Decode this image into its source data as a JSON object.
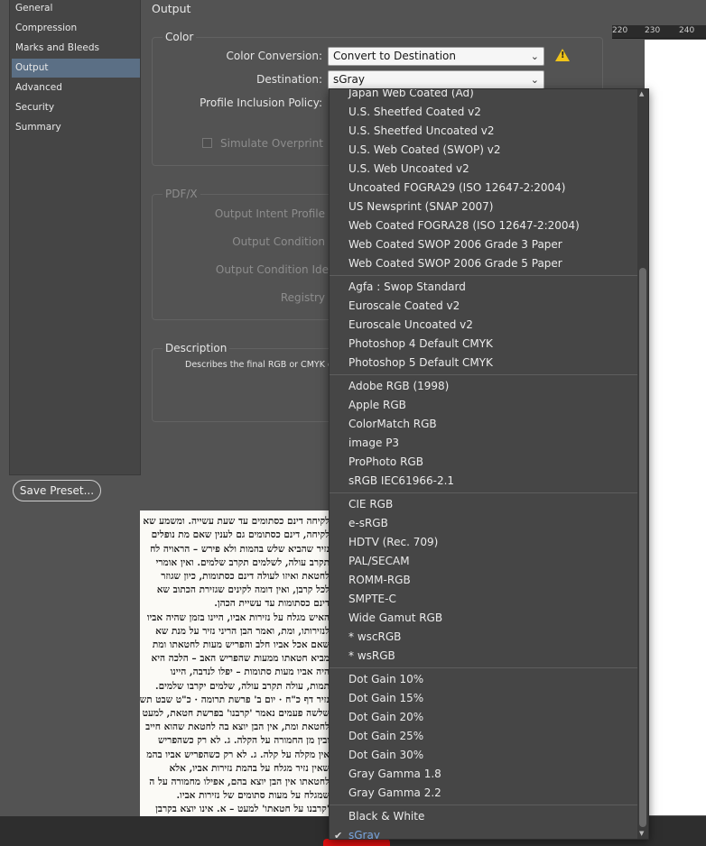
{
  "ruler": {
    "ticks": [
      "220",
      "230",
      "240"
    ]
  },
  "sidebar": {
    "items": [
      {
        "label": "General"
      },
      {
        "label": "Compression"
      },
      {
        "label": "Marks and Bleeds"
      },
      {
        "label": "Output"
      },
      {
        "label": "Advanced"
      },
      {
        "label": "Security"
      },
      {
        "label": "Summary"
      }
    ],
    "active": "Output"
  },
  "header": {
    "title": "Output"
  },
  "color_group": {
    "title": "Color",
    "conversion_label": "Color Conversion:",
    "conversion_value": "Convert to Destination",
    "destination_label": "Destination:",
    "destination_value": "sGray",
    "profile_label": "Profile Inclusion Policy:",
    "overprint_label": "Simulate Overprint"
  },
  "pdfx_group": {
    "title": "PDF/X",
    "intent_label": "Output Intent Profile",
    "condition_label": "Output Condition",
    "identifier_label": "Output Condition Ide",
    "registry_label": "Registry"
  },
  "description_group": {
    "title": "Description",
    "text": "Describes the final RGB or CMYK ou"
  },
  "buttons": {
    "save_preset": "Save Preset..."
  },
  "dropdown": {
    "selected": "sGray",
    "groups": [
      [
        "Japan Web Coated (Ad)",
        "U.S. Sheetfed Coated v2",
        "U.S. Sheetfed Uncoated v2",
        "U.S. Web Coated (SWOP) v2",
        "U.S. Web Uncoated v2",
        "Uncoated FOGRA29 (ISO 12647-2:2004)",
        "US Newsprint (SNAP 2007)",
        "Web Coated FOGRA28 (ISO 12647-2:2004)",
        "Web Coated SWOP 2006 Grade 3 Paper",
        "Web Coated SWOP 2006 Grade 5 Paper"
      ],
      [
        "Agfa : Swop Standard",
        "Euroscale Coated v2",
        "Euroscale Uncoated v2",
        "Photoshop 4 Default CMYK",
        "Photoshop 5 Default CMYK"
      ],
      [
        "Adobe RGB (1998)",
        "Apple RGB",
        "ColorMatch RGB",
        "image P3",
        "ProPhoto RGB",
        "sRGB IEC61966-2.1"
      ],
      [
        "CIE RGB",
        "e-sRGB",
        "HDTV (Rec. 709)",
        "PAL/SECAM",
        "ROMM-RGB",
        "SMPTE-C",
        "Wide Gamut RGB",
        "* wscRGB",
        "* wsRGB"
      ],
      [
        "Dot Gain 10%",
        "Dot Gain 15%",
        "Dot Gain 20%",
        "Dot Gain 25%",
        "Dot Gain 30%",
        "Gray Gamma 1.8",
        "Gray Gamma 2.2"
      ],
      [
        "Black & White",
        "sGray"
      ]
    ]
  },
  "document": {
    "lines": [
      "האחד חטאת ואת האחד עולה' – אמר רחמנא שאם",
      "לקיחה דינם כסתומים עד שעת עשייה. ומשמע שא",
      "לקיחה, דינם כסתומים גם לענין שאם מת נופלים",
      "נזיר שהביא שלש בהמות ולא פירש – הראויה לח",
      "תקרב עולה, לשלמים תקרב שלמים. ואין אומרי",
      "לחטאת ואיזו לעולה דינם כסתומות, כיון שגוזר",
      "לכל קרבן, ואין דומה לקינים שגזירת הכתוב שא",
      "דינם כסתומות עד עשיית הכהן.",
      "האיש מגלח על נזירות אביו, היינו בזמן שהיה אביו",
      "לנזירותו, ומת, ואמר הבן הריני נזיר על מנת שא",
      "שאם אכל אביו חלב והפריש מעות לחטאתו ומת",
      "מביא חטאתו ממעות שהפריש האב – הלכה היא",
      "היה אביו מעות סתומות – יפלו לנדבה, היינו",
      "תמות, עולה תקרב עולה, שלמים יקרבו שלמים.",
      "נזיר דף כ\"ח · יום ב' פרשת תרומה · כ\"ט שבט תשפ\"ג",
      "שלשה פעמים נאמר 'קרבנו' בפרשת חטאת, למעט",
      "לחטאת ומת, אין הבן יוצא בה לחטאת שהוא חייב",
      "ובין מן החמורה על הקלה. ג. לא רק כשהפריש",
      "אין מקלה על קלה. ג. לא רק כשהפריש אביו בהמ",
      "שאין נזיר מגלח על בהמת נזירות אביו, אלא",
      "לחטאתו אין הבן יוצא בהם, אפילו מחמורה על ה",
      "שמגלח על מעות סתומים של נזירות אביו.",
      "'קרבנו על חטאתו' למעט – א. אינו יוצא בקרבן"
    ]
  }
}
